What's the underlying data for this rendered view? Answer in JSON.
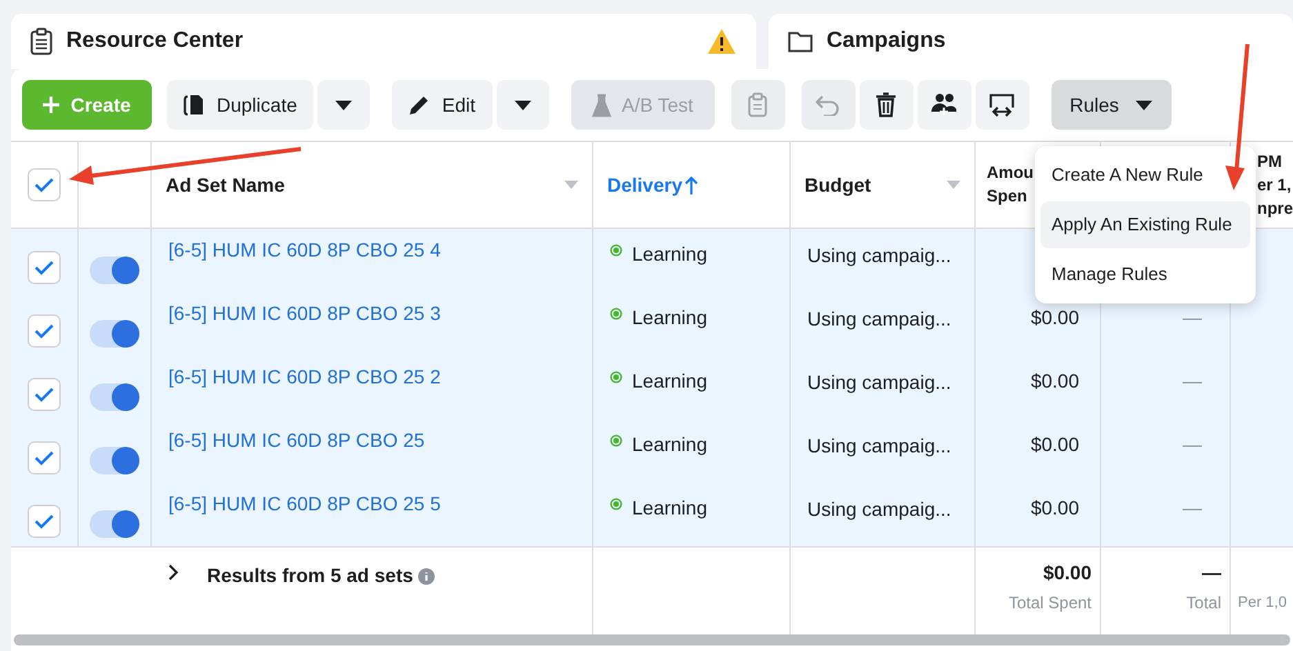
{
  "cards": [
    {
      "title": "Resource Center",
      "warning": true
    },
    {
      "title": "Campaigns",
      "warning": false
    }
  ],
  "toolbar": [
    {
      "kind": "primary",
      "label": "Create",
      "disabled": false
    },
    {
      "kind": "split",
      "label": "Duplicate",
      "disabled": false
    },
    {
      "kind": "split",
      "label": "Edit",
      "disabled": false
    },
    {
      "kind": "labeled",
      "label": "A/B Test",
      "disabled": true
    },
    {
      "kind": "icon",
      "disabled": true
    },
    {
      "kind": "icon",
      "disabled": true
    },
    {
      "kind": "icon",
      "disabled": false
    },
    {
      "kind": "icon",
      "disabled": false
    },
    {
      "kind": "icon",
      "disabled": false
    },
    {
      "kind": "menu",
      "label": "Rules",
      "disabled": false,
      "expanded": true
    }
  ],
  "table": {
    "select_all": {
      "checked": true
    },
    "columns": [
      {
        "label": "Ad Set Name",
        "sorted": false
      },
      {
        "label": "Delivery",
        "sorted": true
      },
      {
        "label": "Budget",
        "sorted": false
      },
      {
        "label": "Amou\nSpen",
        "sorted": false
      },
      {
        "label": "PM\ner 1,\nnpre",
        "sorted": false
      }
    ],
    "rows": [
      {
        "selected": true,
        "on": true,
        "name": "[6-5] HUM IC 60D 8P CBO 25 4",
        "delivery": "Learning",
        "budget": "Using campaig..."
      },
      {
        "selected": true,
        "on": true,
        "name": "[6-5] HUM IC 60D 8P CBO 25 3",
        "delivery": "Learning",
        "budget": "Using campaig...",
        "amount": "$0.00",
        "results": "—"
      },
      {
        "selected": true,
        "on": true,
        "name": "[6-5] HUM IC 60D 8P CBO 25 2",
        "delivery": "Learning",
        "budget": "Using campaig...",
        "amount": "$0.00",
        "results": "—"
      },
      {
        "selected": true,
        "on": true,
        "name": "[6-5] HUM IC 60D 8P CBO 25",
        "delivery": "Learning",
        "budget": "Using campaig...",
        "amount": "$0.00",
        "results": "—"
      },
      {
        "selected": true,
        "on": true,
        "name": "[6-5] HUM IC 60D 8P CBO 25 5",
        "delivery": "Learning",
        "budget": "Using campaig...",
        "amount": "$0.00",
        "results": "—"
      }
    ],
    "footer": {
      "label": "Results from 5 ad sets",
      "amount": "$0.00",
      "amount_note": "Total Spent",
      "results": "—",
      "results_note": "Total",
      "column_7_note": "Per 1,0"
    }
  },
  "rules_menu": [
    {
      "label": "Create A New Rule",
      "highlighted": false
    },
    {
      "label": "Apply An Existing Rule",
      "highlighted": true
    },
    {
      "label": "Manage Rules",
      "highlighted": false
    }
  ]
}
